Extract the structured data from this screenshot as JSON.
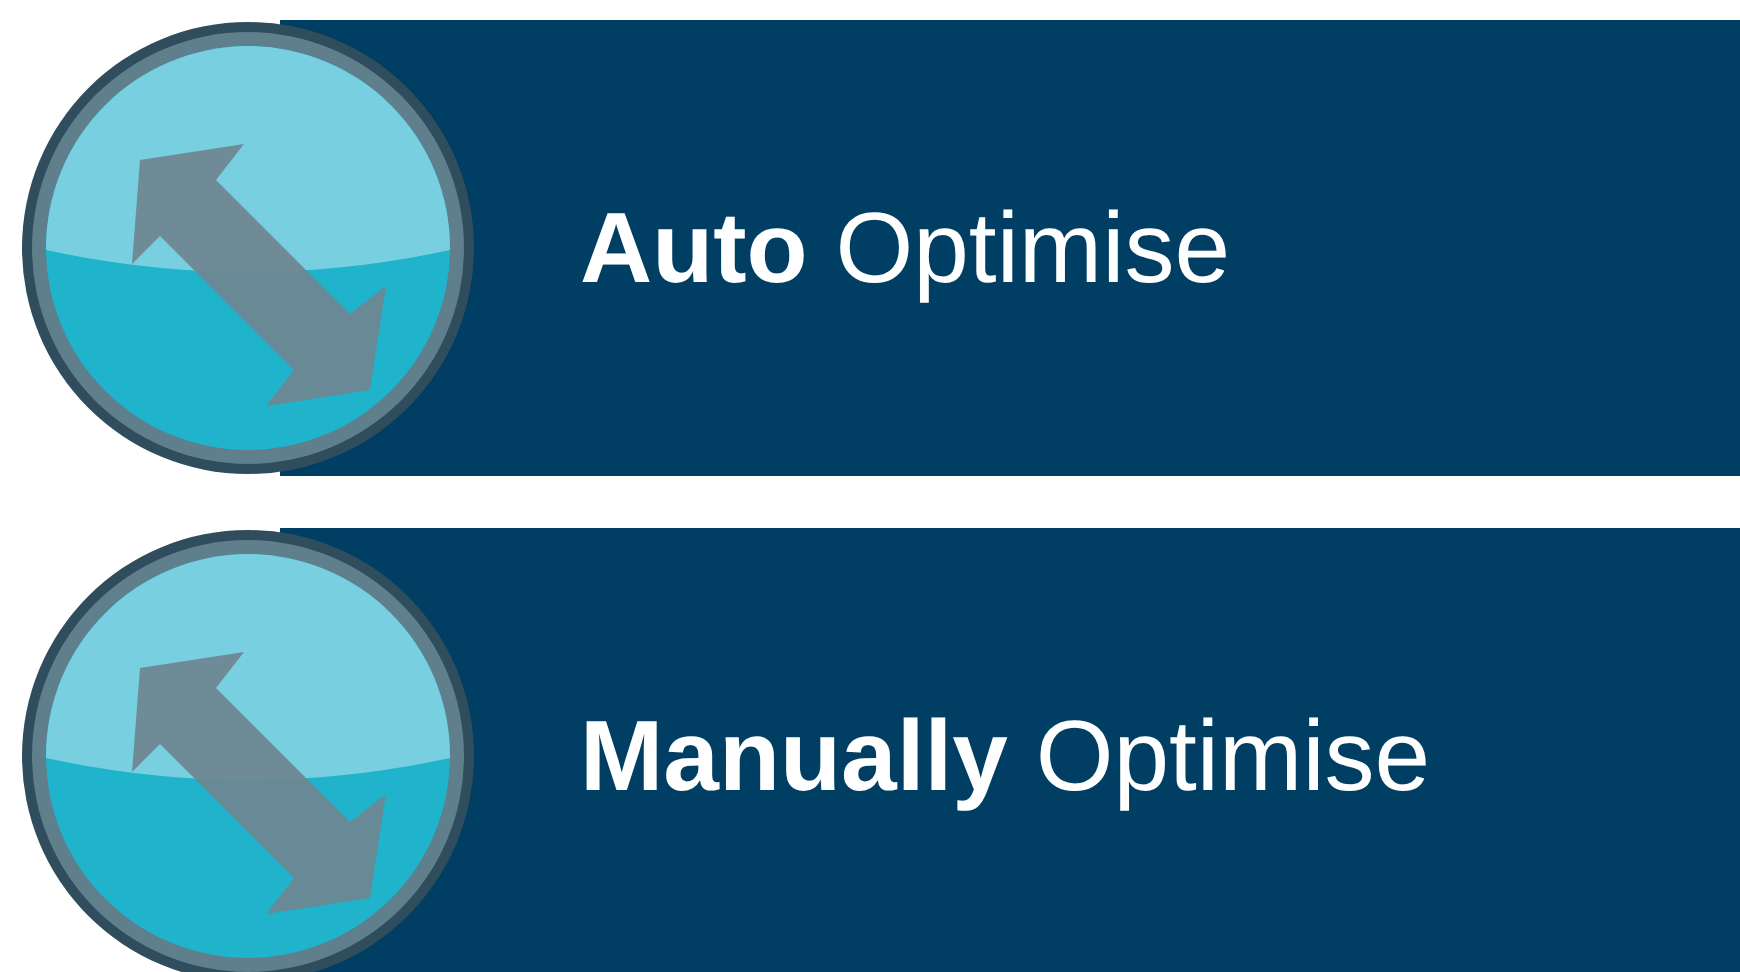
{
  "buttons": [
    {
      "label": "**Auto** Optimise"
    },
    {
      "label": "**Manually** Optimise"
    }
  ]
}
